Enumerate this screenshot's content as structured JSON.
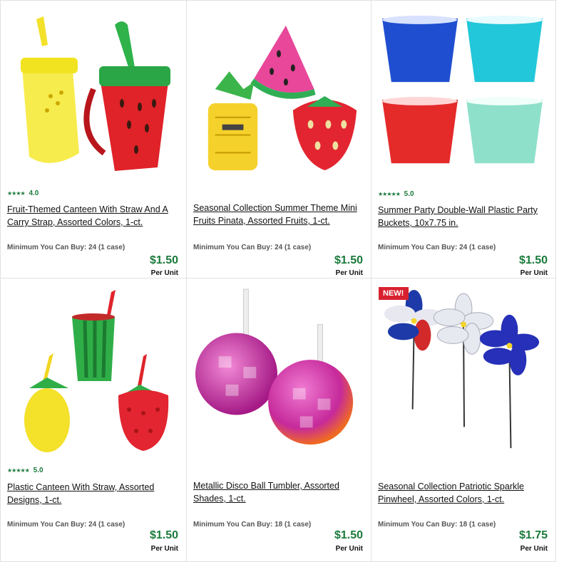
{
  "products": [
    {
      "rating_stars": "★★★★",
      "rating_value": "4.0",
      "title": "Fruit-Themed Canteen With Straw And A Carry Strap, Assorted Colors, 1-ct.",
      "min_buy": "Minimum You Can Buy: 24 (1 case)",
      "price": "$1.50",
      "per_unit": "Per Unit",
      "image_icon": "fruit-canteens-image"
    },
    {
      "rating_stars": "",
      "rating_value": "",
      "title": "Seasonal Collection Summer Theme Mini Fruits Pinata, Assorted Fruits, 1-ct.",
      "min_buy": "Minimum You Can Buy: 24 (1 case)",
      "price": "$1.50",
      "per_unit": "Per Unit",
      "image_icon": "fruit-pinata-image"
    },
    {
      "rating_stars": "★★★★★",
      "rating_value": "5.0",
      "title": "Summer Party Double-Wall Plastic Party Buckets, 10x7.75 in.",
      "min_buy": "Minimum You Can Buy: 24 (1 case)",
      "price": "$1.50",
      "per_unit": "Per Unit",
      "image_icon": "party-buckets-image"
    },
    {
      "rating_stars": "★★★★★",
      "rating_value": "5.0",
      "title": "Plastic Canteen With Straw, Assorted Designs, 1-ct.",
      "min_buy": "Minimum You Can Buy: 24 (1 case)",
      "price": "$1.50",
      "per_unit": "Per Unit",
      "image_icon": "plastic-canteen-image"
    },
    {
      "rating_stars": "",
      "rating_value": "",
      "title": "Metallic Disco Ball Tumbler, Assorted Shades, 1-ct.",
      "min_buy": "Minimum You Can Buy: 18 (1 case)",
      "price": "$1.50",
      "per_unit": "Per Unit",
      "image_icon": "disco-tumbler-image"
    },
    {
      "rating_stars": "",
      "rating_value": "",
      "badge": "NEW!",
      "title": "Seasonal Collection Patriotic Sparkle Pinwheel, Assorted Colors, 1-ct.",
      "min_buy": "Minimum You Can Buy: 18 (1 case)",
      "price": "$1.75",
      "per_unit": "Per Unit",
      "image_icon": "pinwheel-image"
    }
  ],
  "colors": {
    "price_green": "#1a7a3a",
    "rating_green": "#1b7a3c",
    "badge_red": "#d8212f"
  }
}
